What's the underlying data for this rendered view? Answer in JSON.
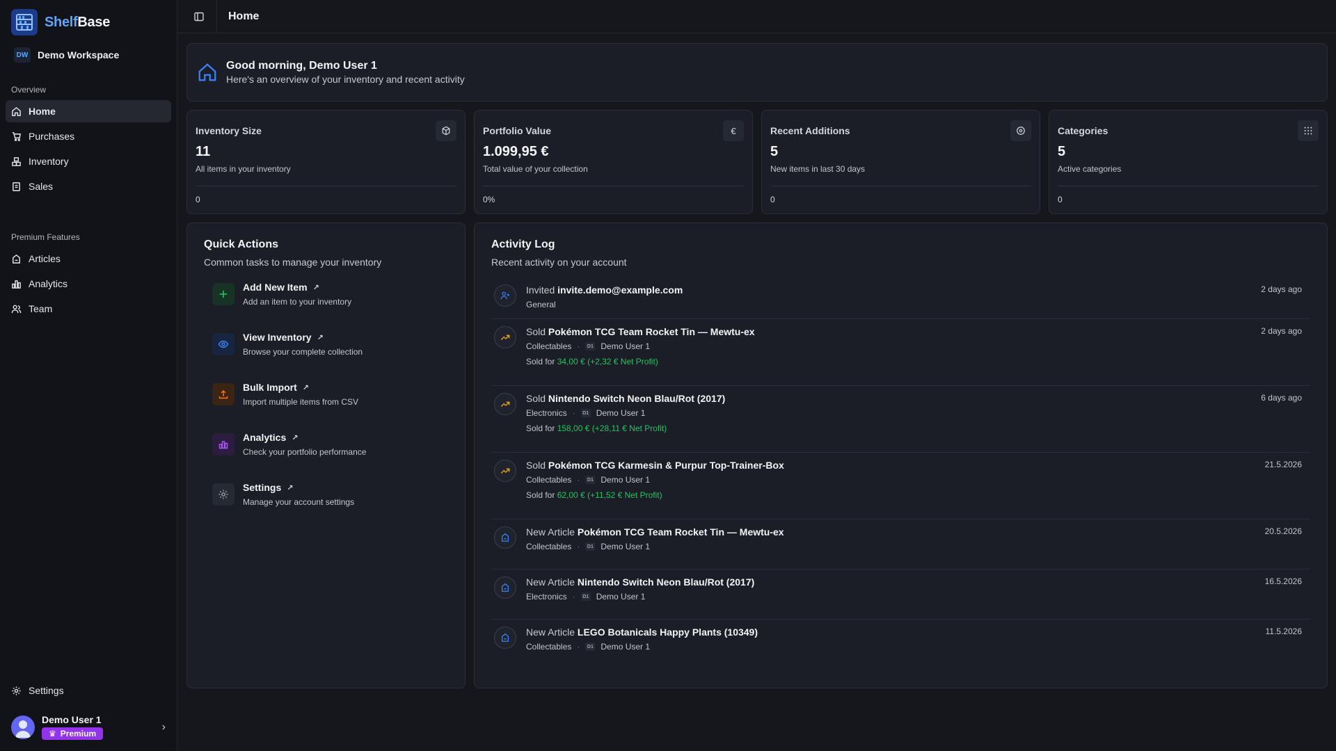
{
  "brand": {
    "part1": "Shelf",
    "part2": "Base"
  },
  "workspace": {
    "badge": "DW",
    "name": "Demo Workspace"
  },
  "nav": {
    "overview_heading": "Overview",
    "overview_items": [
      {
        "label": "Home",
        "icon": "home-icon",
        "active": true
      },
      {
        "label": "Purchases",
        "icon": "cart-icon"
      },
      {
        "label": "Inventory",
        "icon": "boxes-icon"
      },
      {
        "label": "Sales",
        "icon": "receipt-icon"
      }
    ],
    "premium_heading": "Premium Features",
    "premium_items": [
      {
        "label": "Articles",
        "icon": "article-icon"
      },
      {
        "label": "Analytics",
        "icon": "bar-chart-icon"
      },
      {
        "label": "Team",
        "icon": "team-icon"
      }
    ],
    "settings_label": "Settings"
  },
  "user": {
    "name": "Demo User 1",
    "badge": "Premium"
  },
  "topbar": {
    "title": "Home"
  },
  "welcome": {
    "title": "Good morning, Demo User 1",
    "subtitle": "Here's an overview of your inventory and recent activity"
  },
  "stats": [
    {
      "label": "Inventory Size",
      "value": "11",
      "desc": "All items in your inventory",
      "foot": "0",
      "icon": "package-icon"
    },
    {
      "label": "Portfolio Value",
      "value": "1.099,95 €",
      "desc": "Total value of your collection",
      "foot": "0%",
      "icon": "euro-icon",
      "icon_text": "€"
    },
    {
      "label": "Recent Additions",
      "value": "5",
      "desc": "New items in last 30 days",
      "foot": "0",
      "icon": "plus-circle-icon"
    },
    {
      "label": "Categories",
      "value": "5",
      "desc": "Active categories",
      "foot": "0",
      "icon": "grid-icon"
    }
  ],
  "quick_actions": {
    "title": "Quick Actions",
    "subtitle": "Common tasks to manage your inventory",
    "items": [
      {
        "name": "Add New Item",
        "desc": "Add an item to your inventory",
        "icon": "plus-icon",
        "color": "#22c55e"
      },
      {
        "name": "View Inventory",
        "desc": "Browse your complete collection",
        "icon": "eye-icon",
        "color": "#3b82f6"
      },
      {
        "name": "Bulk Import",
        "desc": "Import multiple items from CSV",
        "icon": "upload-icon",
        "color": "#f97316"
      },
      {
        "name": "Analytics",
        "desc": "Check your portfolio performance",
        "icon": "bar-chart-icon",
        "color": "#a855f7"
      },
      {
        "name": "Settings",
        "desc": "Manage your account settings",
        "icon": "gear-icon",
        "color": "#9ca3af"
      }
    ]
  },
  "activity": {
    "title": "Activity Log",
    "subtitle": "Recent activity on your account",
    "items": [
      {
        "verb": "Invited",
        "subject": "invite.demo@example.com",
        "category": "General",
        "user": "",
        "time": "2 days ago",
        "icon": "user-plus-icon"
      },
      {
        "verb": "Sold",
        "subject": "Pokémon TCG Team Rocket Tin — Mewtu-ex",
        "category": "Collectables",
        "user": "Demo User 1",
        "sale_prefix": "Sold for",
        "sale_price": "34,00 €",
        "sale_profit": "(+2,32 € Net Profit)",
        "time": "2 days ago",
        "icon": "trending-up-icon"
      },
      {
        "verb": "Sold",
        "subject": "Nintendo Switch Neon Blau/Rot (2017)",
        "category": "Electronics",
        "user": "Demo User 1",
        "sale_prefix": "Sold for",
        "sale_price": "158,00 €",
        "sale_profit": "(+28,11 € Net Profit)",
        "time": "6 days ago",
        "icon": "trending-up-icon"
      },
      {
        "verb": "Sold",
        "subject": "Pokémon TCG Karmesin & Purpur Top-Trainer-Box",
        "category": "Collectables",
        "user": "Demo User 1",
        "sale_prefix": "Sold for",
        "sale_price": "62,00 €",
        "sale_profit": "(+11,52 € Net Profit)",
        "time": "21.5.2026",
        "icon": "trending-up-icon"
      },
      {
        "verb": "New Article",
        "subject": "Pokémon TCG Team Rocket Tin — Mewtu-ex",
        "category": "Collectables",
        "user": "Demo User 1",
        "time": "20.5.2026",
        "icon": "article-icon"
      },
      {
        "verb": "New Article",
        "subject": "Nintendo Switch Neon Blau/Rot (2017)",
        "category": "Electronics",
        "user": "Demo User 1",
        "time": "16.5.2026",
        "icon": "article-icon"
      },
      {
        "verb": "New Article",
        "subject": "LEGO Botanicals Happy Plants (10349)",
        "category": "Collectables",
        "user": "Demo User 1",
        "time": "11.5.2026",
        "icon": "article-icon"
      }
    ]
  },
  "mini_avatar_initials": "D1"
}
